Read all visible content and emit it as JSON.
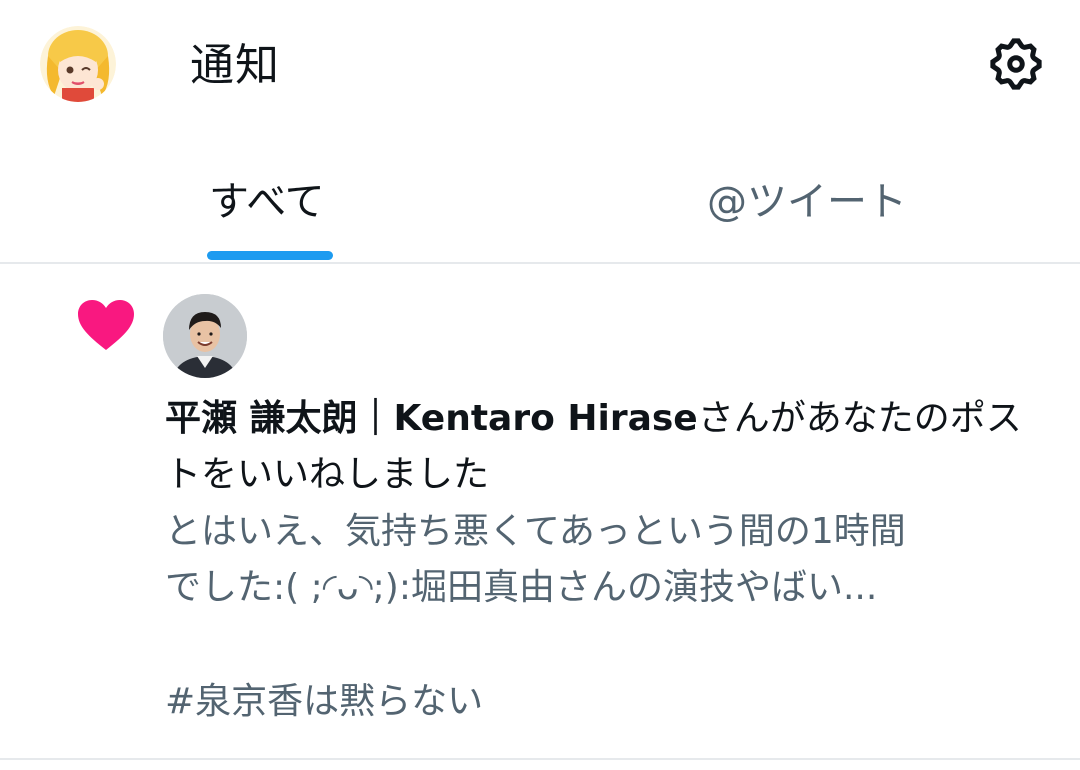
{
  "header": {
    "title": "通知",
    "avatar_icon": "anime-avatar-icon",
    "settings_icon": "gear-icon"
  },
  "tabs": [
    {
      "label": "すべて",
      "active": true
    },
    {
      "label": "@ツイート",
      "active": false
    }
  ],
  "notification": {
    "type": "like",
    "icon": "heart-icon",
    "icon_color": "#f91880",
    "user_name": "平瀬 謙太朗｜Kentaro Hirase",
    "action_text": "さんがあなたのポストをいいねしました",
    "snippet_line1": "とはいえ、気持ち悪くてあっという間の1時間",
    "snippet_line2": "でした:( ;◜ᴗ◝;):堀田真由さんの演技やばい...",
    "hashtag": "#泉京香は黙らない"
  },
  "colors": {
    "accent": "#1d9bf0",
    "like": "#f91880",
    "secondary_text": "#536471",
    "primary_text": "#0f1419"
  }
}
